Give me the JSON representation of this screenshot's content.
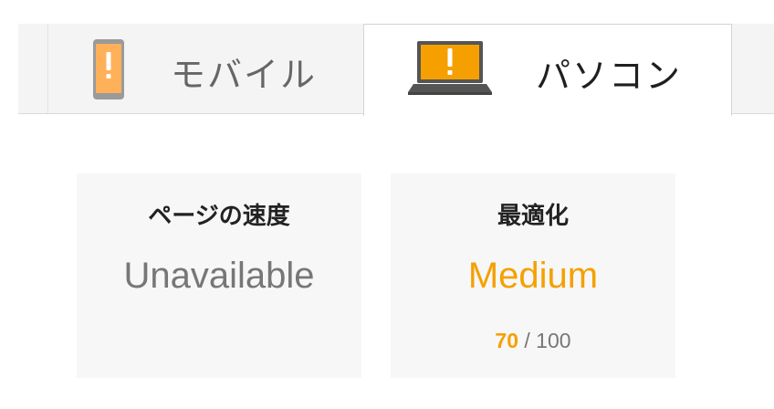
{
  "tabs": {
    "mobile": {
      "label": "モバイル",
      "icon": "phone-warning-icon"
    },
    "desktop": {
      "label": "パソコン",
      "icon": "laptop-warning-icon",
      "selected": true
    }
  },
  "cards": {
    "speed": {
      "title": "ページの速度",
      "value": "Unavailable"
    },
    "optimization": {
      "title": "最適化",
      "value": "Medium",
      "score": "70",
      "score_max": "/ 100",
      "score_fraction": 0.7
    }
  },
  "colors": {
    "warning_orange": "#f5a000",
    "phone_fill": "#ffb15a",
    "device_gray": "#555555",
    "card_bg": "#f7f7f7",
    "tab_bg": "#f4f4f4"
  }
}
